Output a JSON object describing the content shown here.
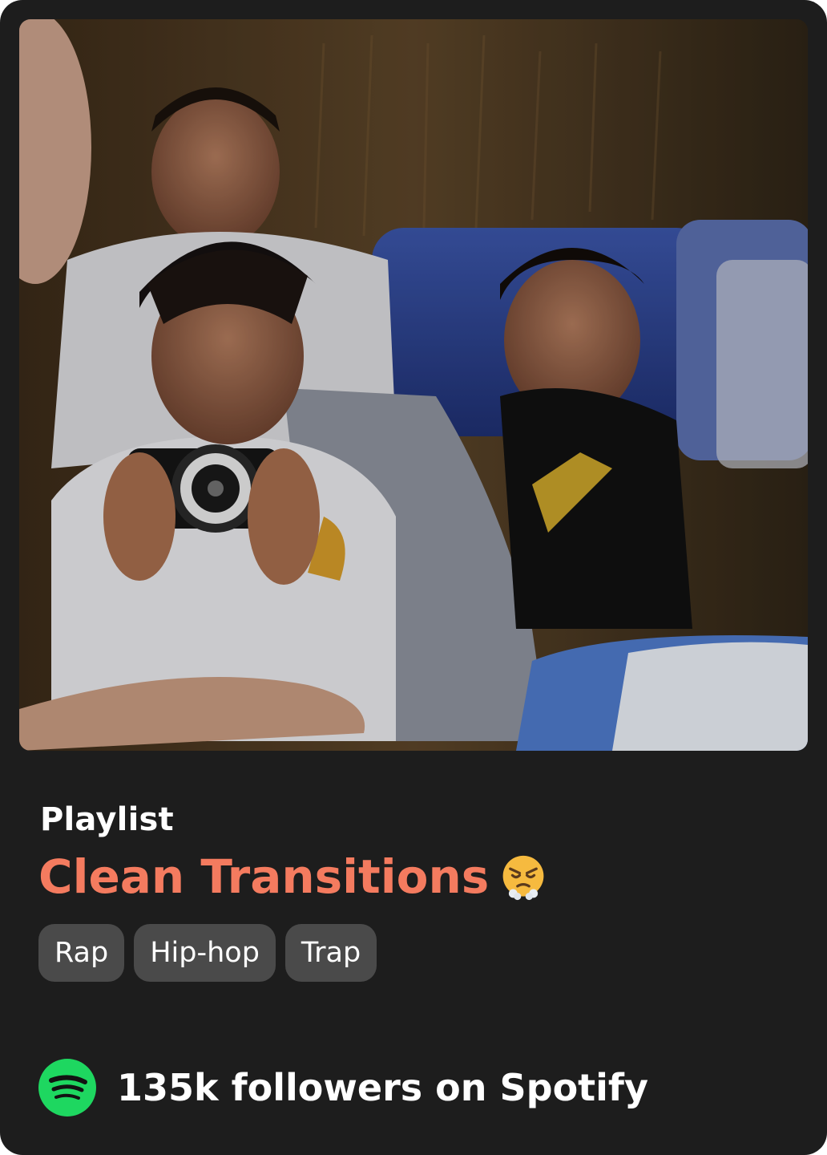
{
  "card": {
    "type_label": "Playlist",
    "title": "Clean Transitions",
    "title_emoji": "face-with-steam-from-nose",
    "title_color": "#f47b5f",
    "tags": [
      "Rap",
      "Hip-hop",
      "Trap"
    ],
    "followers_text": "135k followers on Spotify",
    "brand_icon": "spotify-icon",
    "brand_color": "#1ed760",
    "cover_image": "photo of young men in bus seats, one holding a camera"
  }
}
